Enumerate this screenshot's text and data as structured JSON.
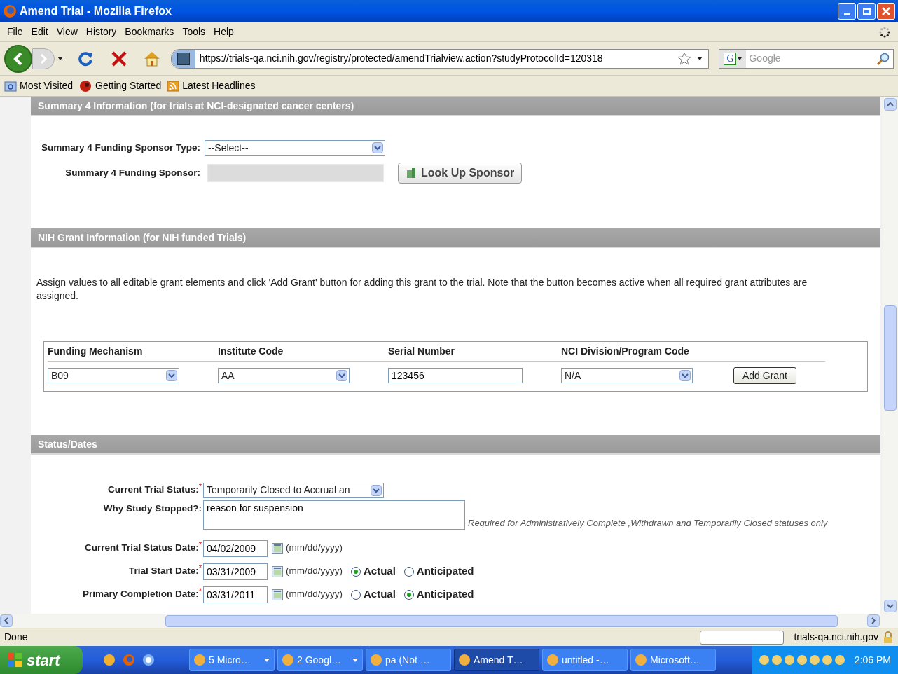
{
  "window": {
    "title": "Amend Trial - Mozilla Firefox"
  },
  "menu": [
    "File",
    "Edit",
    "View",
    "History",
    "Bookmarks",
    "Tools",
    "Help"
  ],
  "toolbar": {
    "url": "https://trials-qa.nci.nih.gov/registry/protected/amendTrialview.action?studyProtocolId=120318",
    "search_engine": "G",
    "search_placeholder": "Google"
  },
  "bookmarks": [
    {
      "label": "Most Visited",
      "kind": "folder"
    },
    {
      "label": "Getting Started",
      "kind": "page"
    },
    {
      "label": "Latest Headlines",
      "kind": "feed"
    }
  ],
  "summary4": {
    "title": "Summary 4 Information (for trials at NCI-designated cancer centers)",
    "fields": [
      {
        "label": "Summary 4 Funding Sponsor Type:",
        "kind": "select",
        "value": "--Select--"
      },
      {
        "label": "Summary 4 Funding Sponsor:",
        "kind": "readonly",
        "button": "Look Up Sponsor"
      }
    ]
  },
  "grant": {
    "title": "NIH Grant Information (for NIH funded Trials)",
    "note": "Assign values to all editable grant elements and click 'Add Grant' button for adding this grant to the trial. Note that the button becomes active when all required grant attributes are assigned.",
    "columns": [
      "Funding Mechanism",
      "Institute Code",
      "Serial Number",
      "NCI Division/Program Code"
    ],
    "row": [
      {
        "kind": "select",
        "value": "B09"
      },
      {
        "kind": "select",
        "value": "AA"
      },
      {
        "kind": "text",
        "value": "123456"
      },
      {
        "kind": "select",
        "value": "N/A"
      }
    ],
    "button": "Add Grant"
  },
  "status": {
    "title": "Status/Dates",
    "required_mark": "*",
    "fields": [
      {
        "label": "Current Trial Status:",
        "required": true,
        "kind": "select",
        "value": "Temporarily Closed to Accrual an"
      },
      {
        "label": "Why Study Stopped?:",
        "required": false,
        "kind": "textarea",
        "value": "reason for suspension",
        "hint": "Required for Administratively Complete ,Withdrawn and Temporarily Closed statuses only"
      },
      {
        "label": "Current Trial Status Date:",
        "required": true,
        "kind": "date",
        "value": "04/02/2009",
        "format": "(mm/dd/yyyy)"
      },
      {
        "label": "Trial Start Date:",
        "required": true,
        "kind": "date",
        "value": "03/31/2009",
        "format": "(mm/dd/yyyy)",
        "options": [
          {
            "label": "Actual",
            "selected": true
          },
          {
            "label": "Anticipated",
            "selected": false
          }
        ]
      },
      {
        "label": "Primary Completion Date:",
        "required": true,
        "kind": "date",
        "value": "03/31/2011",
        "format": "(mm/dd/yyyy)",
        "options": [
          {
            "label": "Actual",
            "selected": false
          },
          {
            "label": "Anticipated",
            "selected": true
          }
        ]
      }
    ]
  },
  "status_bar": {
    "text": "Done",
    "host": "trials-qa.nci.nih.gov"
  },
  "taskbar": {
    "start": "start",
    "tasks": [
      {
        "label": "5 Micro…",
        "kind": "group",
        "selected": false
      },
      {
        "label": "2 Googl…",
        "kind": "group",
        "selected": false
      },
      {
        "label": "pa (Not …",
        "kind": "single",
        "selected": false
      },
      {
        "label": "Amend T…",
        "kind": "single",
        "selected": true
      },
      {
        "label": "untitled -…",
        "kind": "single",
        "selected": false
      },
      {
        "label": "Microsoft…",
        "kind": "single",
        "selected": false
      }
    ],
    "clock": "2:06 PM"
  }
}
